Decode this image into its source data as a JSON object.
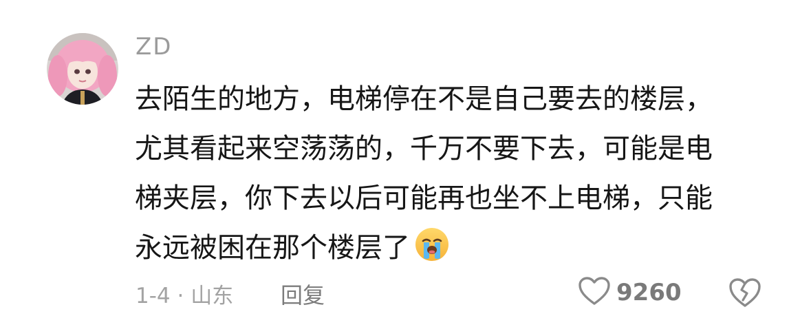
{
  "comment": {
    "username": "ZD",
    "text_lines": [
      "去陌生的地方，电梯停在不是自己要去的楼层，",
      "尤其看起来空荡荡的，千万不要下去，可能是电",
      "梯夹层，你下去以后可能再也坐不上电梯，只能",
      "永远被困在那个楼层了"
    ],
    "emoji": "crying-face-icon",
    "meta": "1-4 · 山东",
    "reply_label": "回复",
    "like_count": "9260"
  },
  "colors": {
    "text": "#161616",
    "muted": "#a3a3a3",
    "icon": "#8a8a8a",
    "avatar_hair": "#f3a7c4"
  }
}
